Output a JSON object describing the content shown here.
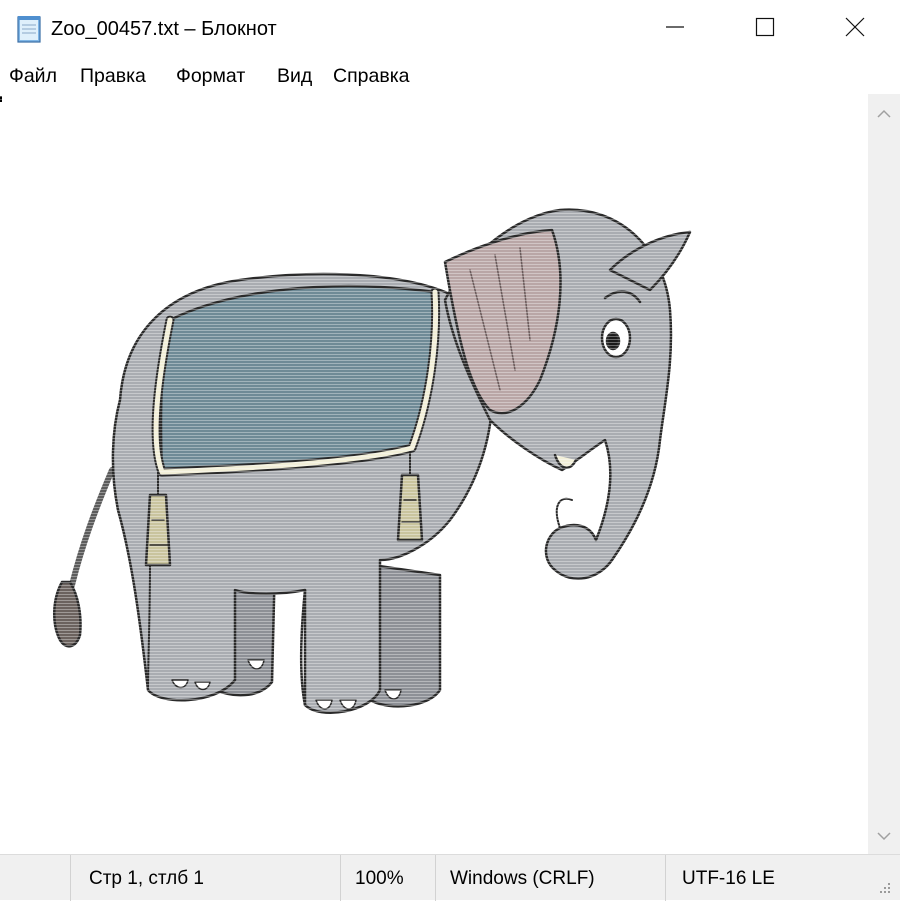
{
  "window": {
    "title": "Zoo_00457.txt – Блокнот",
    "app_icon": "notepad-icon"
  },
  "menu": [
    {
      "label": "Файл"
    },
    {
      "label": "Правка"
    },
    {
      "label": "Формат"
    },
    {
      "label": "Вид"
    },
    {
      "label": "Справка"
    }
  ],
  "editor": {
    "content_image": "elephant-illustration"
  },
  "status": {
    "position": "Стр 1, стлб 1",
    "zoom": "100%",
    "line_endings": "Windows (CRLF)",
    "encoding": "UTF-16 LE"
  },
  "colors": {
    "elephant_body": "#a9acb1",
    "blanket": "#6f8a96",
    "ear_inner": "#b9a6a6",
    "trim": "#f2efd8",
    "outline": "#2a2a2a"
  }
}
